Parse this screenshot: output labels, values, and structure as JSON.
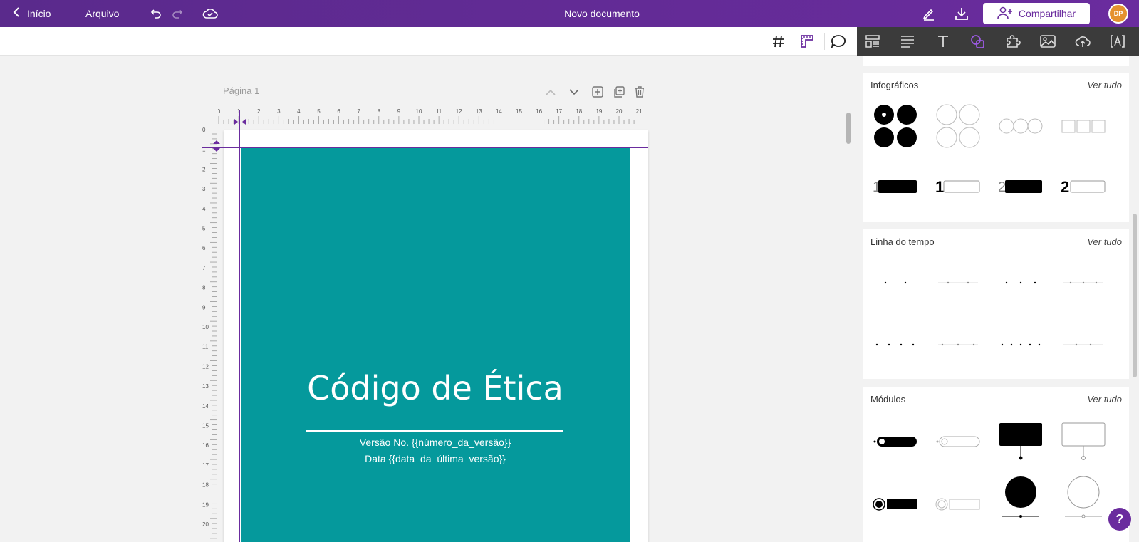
{
  "topbar": {
    "back_label": "Início",
    "file_label": "Arquivo",
    "document_title": "Novo documento",
    "share_label": "Compartilhar",
    "avatar_initials": "DP"
  },
  "canvas": {
    "page_label": "Página 1",
    "ruler_h": [
      "0",
      "1",
      "2",
      "3",
      "4",
      "5",
      "6",
      "7",
      "8",
      "9",
      "10",
      "11",
      "12",
      "13",
      "14",
      "15",
      "16",
      "17",
      "18",
      "19",
      "20",
      "21"
    ],
    "ruler_v": [
      "0",
      "1",
      "2",
      "3",
      "4",
      "5",
      "6",
      "7",
      "8",
      "9",
      "10",
      "11",
      "12",
      "13",
      "14",
      "15",
      "16",
      "17",
      "18",
      "19",
      "20"
    ]
  },
  "cover": {
    "title": "Código de Ética",
    "version_line": "Versão No. {{número_da_versão}}",
    "date_line": "Data {{data_da_última_versão}}",
    "background": "#05999c"
  },
  "panel": {
    "sections": [
      {
        "title": "Infográficos",
        "see_all": "Ver tudo"
      },
      {
        "title": "Linha do tempo",
        "see_all": "Ver tudo"
      },
      {
        "title": "Módulos",
        "see_all": "Ver tudo"
      }
    ]
  },
  "colors": {
    "brand": "#6a2c9e",
    "accent_avatar": "#e5912f"
  }
}
